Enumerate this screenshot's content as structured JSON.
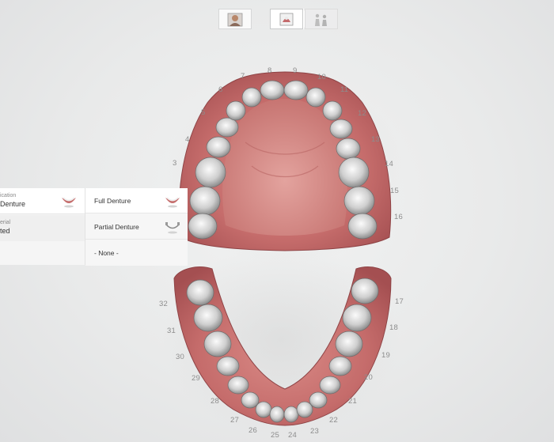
{
  "toolbar": {
    "patient_icon": "patient-photo-icon",
    "denture_icon": "denture-case-icon",
    "group_icon": "people-group-icon"
  },
  "left_panel": {
    "indication_label": "ication",
    "indication_value": "Denture",
    "material_label": "erial",
    "material_value": "ted"
  },
  "options": [
    {
      "label": "Full Denture",
      "icon": "full-denture-icon"
    },
    {
      "label": "Partial Denture",
      "icon": "partial-denture-icon"
    },
    {
      "label": "- None -"
    }
  ],
  "upper_teeth": [
    "3",
    "4",
    "5",
    "6",
    "7",
    "8",
    "9",
    "10",
    "11",
    "12",
    "13",
    "14",
    "15",
    "16"
  ],
  "lower_teeth": [
    "17",
    "18",
    "19",
    "20",
    "21",
    "22",
    "23",
    "24",
    "25",
    "26",
    "27",
    "28",
    "29",
    "30",
    "31",
    "32"
  ],
  "colors": {
    "gum": "#c96f6f",
    "gum_dark": "#9f4a4c",
    "tooth": "#d8d8d8"
  }
}
